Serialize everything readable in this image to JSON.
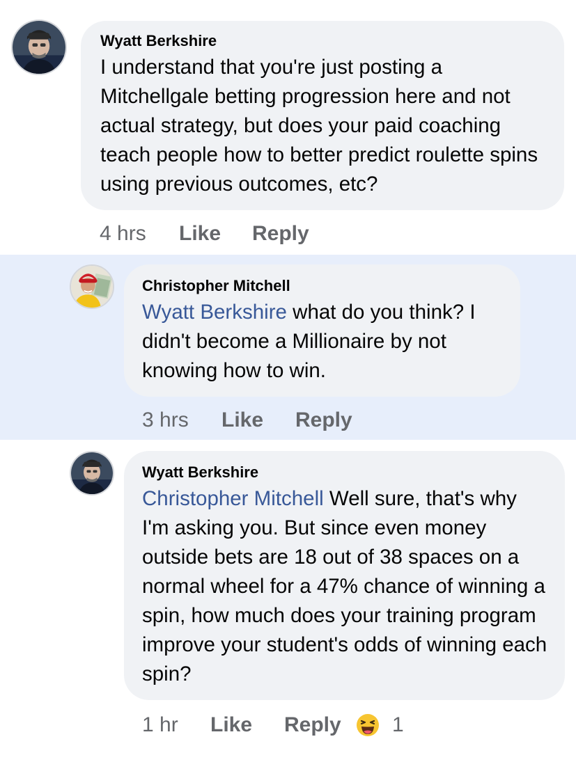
{
  "comments": [
    {
      "author": "Wyatt Berkshire",
      "mention": "",
      "text": "I understand that you're just posting a Mitchellgale betting progression here and not actual strategy, but does your paid coaching teach people how to better predict roulette spins using previous outcomes, etc?",
      "time": "4 hrs",
      "like_label": "Like",
      "reply_label": "Reply"
    },
    {
      "author": "Christopher Mitchell",
      "mention": "Wyatt Berkshire",
      "text": " what do you think? I didn't become a Millionaire by not knowing how to win.",
      "time": "3 hrs",
      "like_label": "Like",
      "reply_label": "Reply"
    },
    {
      "author": "Wyatt Berkshire",
      "mention": "Christopher Mitchell",
      "text": " Well sure, that's why I'm asking you. But since even money outside bets are 18 out of 38 spaces on a normal wheel for a 47% chance of winning a spin, how much does your training program improve your student's odds of winning each spin?",
      "time": "1 hr",
      "like_label": "Like",
      "reply_label": "Reply",
      "reaction": {
        "icon": "haha-emoji-icon",
        "count": "1"
      }
    }
  ],
  "colors": {
    "bubble": "#f0f2f5",
    "highlight": "#e7eefb",
    "mention": "#385898",
    "meta": "#65676b"
  }
}
